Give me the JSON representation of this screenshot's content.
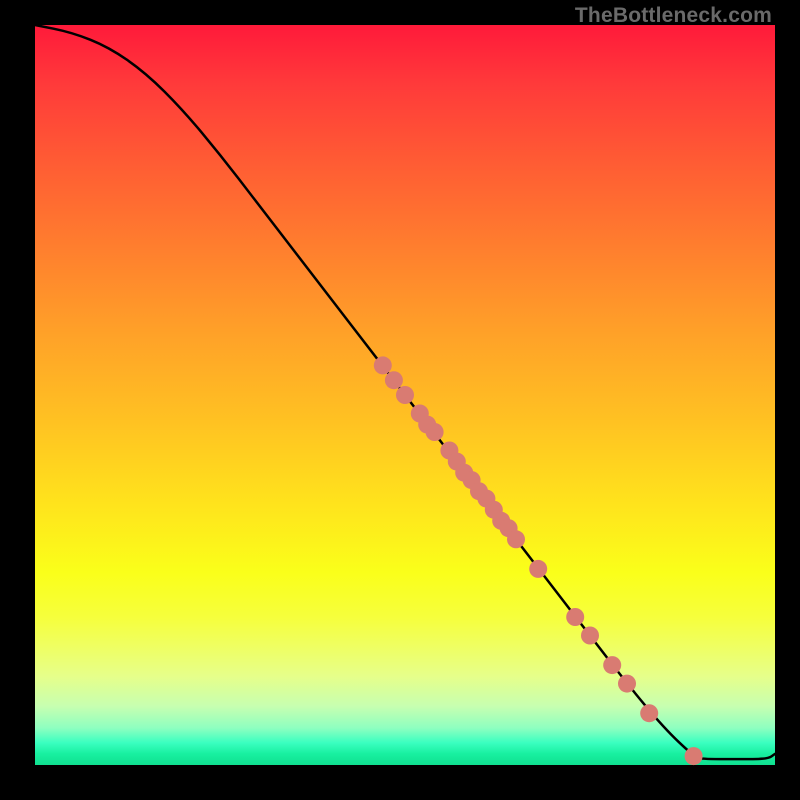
{
  "watermark": "TheBottleneck.com",
  "colors": {
    "curve": "#000000",
    "point_fill": "#d97b72",
    "point_stroke": "#b95a52",
    "frame_bg": "#000000"
  },
  "chart_data": {
    "type": "line",
    "title": "",
    "xlabel": "",
    "ylabel": "",
    "xlim": [
      0,
      100
    ],
    "ylim": [
      0,
      100
    ],
    "curve": [
      {
        "x": 0,
        "y": 100
      },
      {
        "x": 5,
        "y": 99
      },
      {
        "x": 10,
        "y": 97
      },
      {
        "x": 15,
        "y": 93.5
      },
      {
        "x": 20,
        "y": 88.5
      },
      {
        "x": 25,
        "y": 82.5
      },
      {
        "x": 30,
        "y": 76
      },
      {
        "x": 35,
        "y": 69.5
      },
      {
        "x": 40,
        "y": 63
      },
      {
        "x": 45,
        "y": 56.5
      },
      {
        "x": 50,
        "y": 50
      },
      {
        "x": 55,
        "y": 43.5
      },
      {
        "x": 60,
        "y": 37
      },
      {
        "x": 65,
        "y": 30.5
      },
      {
        "x": 70,
        "y": 24
      },
      {
        "x": 75,
        "y": 17.5
      },
      {
        "x": 80,
        "y": 11
      },
      {
        "x": 85,
        "y": 5
      },
      {
        "x": 89,
        "y": 1.2
      },
      {
        "x": 90,
        "y": 0.8
      },
      {
        "x": 95,
        "y": 0.8
      },
      {
        "x": 99,
        "y": 0.8
      },
      {
        "x": 100,
        "y": 1.5
      }
    ],
    "points": [
      {
        "x": 47,
        "y": 54
      },
      {
        "x": 48.5,
        "y": 52
      },
      {
        "x": 50,
        "y": 50
      },
      {
        "x": 52,
        "y": 47.5
      },
      {
        "x": 53,
        "y": 46
      },
      {
        "x": 54,
        "y": 45
      },
      {
        "x": 56,
        "y": 42.5
      },
      {
        "x": 57,
        "y": 41
      },
      {
        "x": 58,
        "y": 39.5
      },
      {
        "x": 59,
        "y": 38.5
      },
      {
        "x": 60,
        "y": 37
      },
      {
        "x": 61,
        "y": 36
      },
      {
        "x": 62,
        "y": 34.5
      },
      {
        "x": 63,
        "y": 33
      },
      {
        "x": 64,
        "y": 32
      },
      {
        "x": 65,
        "y": 30.5
      },
      {
        "x": 68,
        "y": 26.5
      },
      {
        "x": 73,
        "y": 20
      },
      {
        "x": 75,
        "y": 17.5
      },
      {
        "x": 78,
        "y": 13.5
      },
      {
        "x": 80,
        "y": 11
      },
      {
        "x": 83,
        "y": 7
      },
      {
        "x": 89,
        "y": 1.2
      }
    ],
    "point_radius": 9
  }
}
